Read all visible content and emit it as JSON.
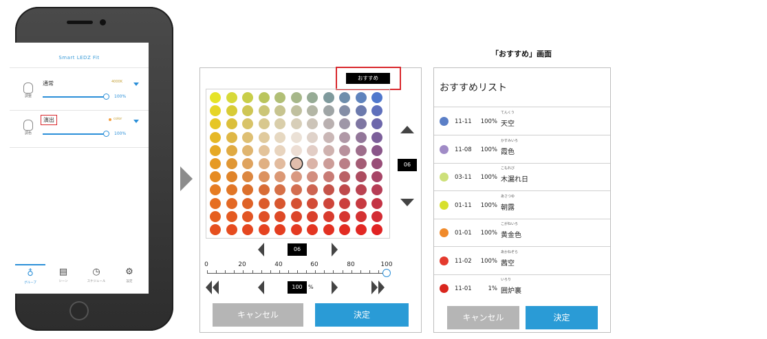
{
  "phone": {
    "app_title": "Smart LEDZ Fit",
    "lights": [
      {
        "icon_caption": "調整",
        "name": "通常",
        "temp": "4000K",
        "percent": "100%",
        "highlighted": false
      },
      {
        "icon_caption": "調色",
        "name": "演出",
        "temp": "color",
        "percent": "100%",
        "highlighted": true
      }
    ],
    "tabs": [
      {
        "label": "グループ",
        "icon": "bulb-icon",
        "active": true
      },
      {
        "label": "シーン",
        "icon": "clapper-icon",
        "active": false
      },
      {
        "label": "スケジュール",
        "icon": "clock-icon",
        "active": false
      },
      {
        "label": "設定",
        "icon": "gear-icon",
        "active": false
      }
    ]
  },
  "picker": {
    "recommend_button": "おすすめ",
    "row_value": "06",
    "col_value": "06",
    "brightness_value": "100",
    "percent_sign": "%",
    "scale_labels": [
      "0",
      "20",
      "40",
      "60",
      "80",
      "100"
    ],
    "cancel_label": "キャンセル",
    "ok_label": "決定"
  },
  "recommend": {
    "caption": "「おすすめ」画面",
    "title": "おすすめリスト",
    "items": [
      {
        "ruby": "てんくう",
        "code": "11-11",
        "percent": "100%",
        "name": "天空",
        "color": "#5b7fc7"
      },
      {
        "ruby": "かすみいろ",
        "code": "11-08",
        "percent": "100%",
        "name": "霞色",
        "color": "#a08bc6"
      },
      {
        "ruby": "こもれび",
        "code": "03-11",
        "percent": "100%",
        "name": "木漏れ日",
        "color": "#cde07a"
      },
      {
        "ruby": "あさつゆ",
        "code": "01-11",
        "percent": "100%",
        "name": "朝露",
        "color": "#d7e02e"
      },
      {
        "ruby": "こがねいろ",
        "code": "01-01",
        "percent": "100%",
        "name": "黄金色",
        "color": "#f08a2a"
      },
      {
        "ruby": "あかねぞら",
        "code": "11-02",
        "percent": "100%",
        "name": "茜空",
        "color": "#e43a2e"
      },
      {
        "ruby": "いろり",
        "code": "11-01",
        "percent": "1%",
        "name": "囲炉裏",
        "color": "#d9261d"
      }
    ],
    "cancel_label": "キャンセル",
    "ok_label": "決定"
  },
  "colors": {
    "accent": "#2a9bd6",
    "highlight_red": "#d9262b",
    "cancel_gray": "#b5b5b5"
  }
}
